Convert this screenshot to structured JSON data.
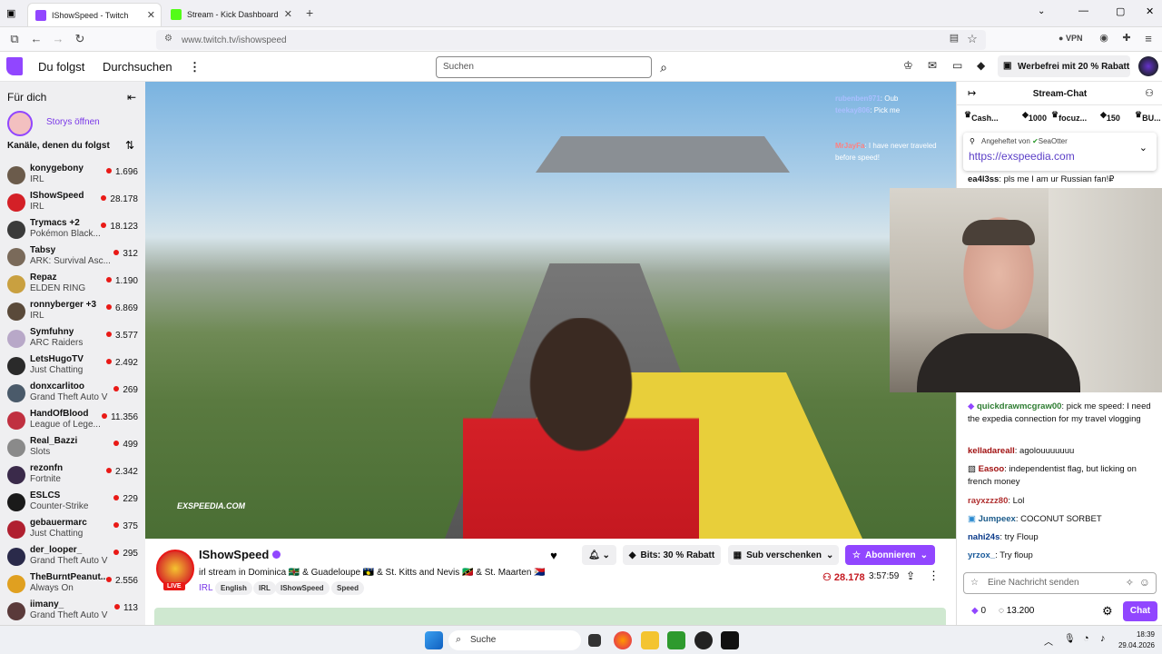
{
  "browser": {
    "tabs": [
      {
        "label": "IShowSpeed - Twitch",
        "active": true
      },
      {
        "label": "Stream - Kick Dashboard",
        "active": false
      }
    ],
    "url": "www.twitch.tv/ishowspeed",
    "vpn_label": "VPN"
  },
  "topnav": {
    "following": "Du folgst",
    "browse": "Durchsuchen",
    "search_placeholder": "Suchen",
    "adfree": "Werbefrei mit 20 % Rabatt"
  },
  "sidebar": {
    "title": "Für dich",
    "stories": "Storys öffnen",
    "followed_header": "Kanäle, denen du folgst",
    "channels": [
      {
        "name": "konygebony",
        "game": "IRL",
        "viewers": "1.696",
        "color": "#6b5b4b"
      },
      {
        "name": "IShowSpeed",
        "game": "IRL",
        "viewers": "28.178",
        "color": "#d42027"
      },
      {
        "name": "Trymacs +2",
        "game": "Pokémon Black...",
        "viewers": "18.123",
        "color": "#3a3a3a"
      },
      {
        "name": "Tabsy",
        "game": "ARK: Survival Asc...",
        "viewers": "312",
        "color": "#7a6a5a"
      },
      {
        "name": "Repaz",
        "game": "ELDEN RING",
        "viewers": "1.190",
        "color": "#c9a040"
      },
      {
        "name": "ronnyberger +3",
        "game": "IRL",
        "viewers": "6.869",
        "color": "#5a4a3a"
      },
      {
        "name": "Symfuhny",
        "game": "ARC Raiders",
        "viewers": "3.577",
        "color": "#b8a8c8"
      },
      {
        "name": "LetsHugoTV",
        "game": "Just Chatting",
        "viewers": "2.492",
        "color": "#2a2a2a"
      },
      {
        "name": "donxcarlitoo",
        "game": "Grand Theft Auto V",
        "viewers": "269",
        "color": "#4a5a6a"
      },
      {
        "name": "HandOfBlood",
        "game": "League of Lege...",
        "viewers": "11.356",
        "color": "#c03040"
      },
      {
        "name": "Real_Bazzi",
        "game": "Slots",
        "viewers": "499",
        "color": "#8a8a8a"
      },
      {
        "name": "rezonfn",
        "game": "Fortnite",
        "viewers": "2.342",
        "color": "#3a2a4a"
      },
      {
        "name": "ESLCS",
        "game": "Counter-Strike",
        "viewers": "229",
        "color": "#1a1a1a"
      },
      {
        "name": "gebauermarc",
        "game": "Just Chatting",
        "viewers": "375",
        "color": "#b02030"
      },
      {
        "name": "der_looper_",
        "game": "Grand Theft Auto V",
        "viewers": "295",
        "color": "#2a2a4a"
      },
      {
        "name": "TheBurntPeanut...",
        "game": "Always On",
        "viewers": "2.556",
        "color": "#e0a020"
      },
      {
        "name": "iimany_",
        "game": "Grand Theft Auto V",
        "viewers": "113",
        "color": "#5a3a3a"
      }
    ]
  },
  "video": {
    "watermark": "EXSPEEDIA.COM"
  },
  "stream": {
    "channel": "IShowSpeed",
    "live": "LIVE",
    "title": "irl stream in Dominica 🇩🇲 & Guadeloupe 🇬🇵 & St. Kitts and Nevis 🇰🇳 & St. Maarten 🇸🇽",
    "category": "IRL",
    "tags": [
      "English",
      "IRL",
      "IShowSpeed",
      "Speed"
    ],
    "bits_btn": "Bits: 30 % Rabatt",
    "gift_btn": "Sub verschenken",
    "subscribe_btn": "Abonnieren",
    "viewers": "28.178",
    "uptime": "3:57:59"
  },
  "chat": {
    "title": "Stream-Chat",
    "leaderboard": [
      {
        "name": "Cash...",
        "value": ""
      },
      {
        "name": "",
        "value": "1000"
      },
      {
        "name": "focuz...",
        "value": ""
      },
      {
        "name": "",
        "value": "150"
      },
      {
        "name": "BU...",
        "value": ""
      }
    ],
    "pinned_by": "Angeheftet von",
    "pinned_user": "SeaOtter",
    "pinned_link": "https://exspeedia.com",
    "overlay_messages": [
      {
        "user": "rubenben971",
        "text": "Oub"
      },
      {
        "user": "teekay806",
        "text": "Pick me"
      },
      {
        "user": "MrJayFa",
        "text": "I have never traveled before speed!"
      }
    ],
    "messages": [
      {
        "user": "ea4l3ss",
        "text": "pls me I am ur Russian fan!₽",
        "color": "#111111"
      },
      {
        "user": "quickdrawmcgraw00",
        "text": "pick me speed: I need the expedia connection for my travel vlogging",
        "color": "#2e7d32"
      },
      {
        "user": "kelladareall",
        "text": "agolouuuuuuu",
        "color": "#a01010"
      },
      {
        "user": "Easoo",
        "text": "independentist flag, but licking on french money",
        "color": "#a01010"
      },
      {
        "user": "rayxzzz80",
        "text": "Lol",
        "color": "#b03030"
      },
      {
        "user": "Jumpeex",
        "text": "COCONUT SORBET",
        "color": "#1a5a8a"
      },
      {
        "user": "nahi24s",
        "text": "try Floup",
        "color": "#0a3a8a"
      },
      {
        "user": "yrzox_",
        "text": "Try floup",
        "color": "#1a5a9a"
      }
    ],
    "input_placeholder": "Eine Nachricht senden",
    "points_a": "0",
    "points_b": "13.200",
    "send_label": "Chat"
  },
  "taskbar": {
    "search": "Suche",
    "time": "18:39",
    "date": "29.04.2026"
  }
}
